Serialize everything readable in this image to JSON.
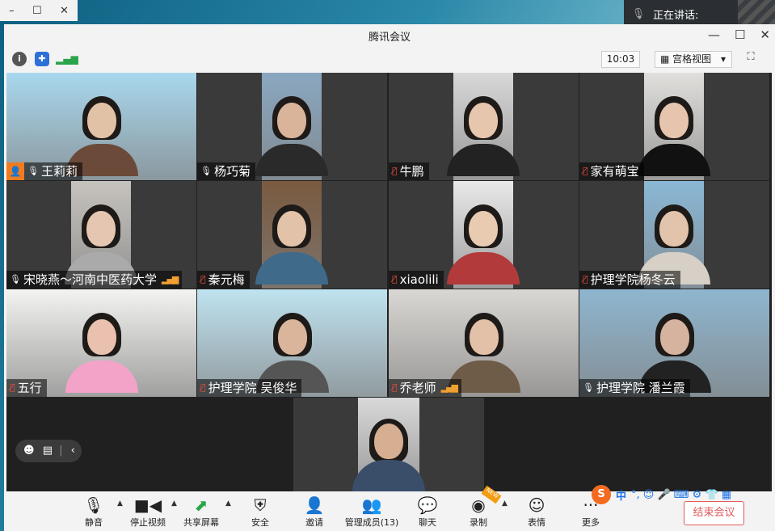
{
  "bg_window": {
    "minimize": "–",
    "maximize": "☐",
    "close": "✕"
  },
  "speaking": {
    "label": "正在讲话:"
  },
  "window": {
    "title": "腾讯会议",
    "minimize": "—",
    "maximize": "☐",
    "close": "✕"
  },
  "info_bar": {
    "time": "10:03",
    "view_label": "宫格视图",
    "view_caret": "▾",
    "fullscreen": "⛶"
  },
  "participants": [
    {
      "name": "王莉莉",
      "mic_on": true,
      "host": true,
      "signal": false
    },
    {
      "name": "杨巧菊",
      "mic_on": true,
      "host": false,
      "signal": false
    },
    {
      "name": "牛鹏",
      "mic_on": false,
      "host": false,
      "signal": false
    },
    {
      "name": "家有萌宝",
      "mic_on": false,
      "host": false,
      "signal": false
    },
    {
      "name": "宋晓燕～河南中医药大学",
      "mic_on": true,
      "host": false,
      "signal": true
    },
    {
      "name": "秦元梅",
      "mic_on": false,
      "host": false,
      "signal": false
    },
    {
      "name": "xiaolili",
      "mic_on": false,
      "host": false,
      "signal": false
    },
    {
      "name": "护理学院杨冬云",
      "mic_on": false,
      "host": false,
      "signal": false
    },
    {
      "name": "五行",
      "mic_on": false,
      "host": false,
      "signal": false
    },
    {
      "name": "护理学院 吴俊华",
      "mic_on": false,
      "host": false,
      "signal": false
    },
    {
      "name": "乔老师",
      "mic_on": false,
      "host": false,
      "signal": true
    },
    {
      "name": "护理学院 潘兰霞",
      "mic_on": true,
      "host": false,
      "signal": false
    },
    {
      "name": "",
      "mic_on": false,
      "host": false,
      "signal": false
    }
  ],
  "chat_control": {
    "emoji": "☻",
    "chat": "▤",
    "collapse": "‹"
  },
  "toolbar": {
    "mute": "静音",
    "stop_video": "停止视频",
    "share_screen": "共享屏幕",
    "security": "安全",
    "invite": "邀请",
    "members": "管理成员(13)",
    "chat": "聊天",
    "record": "录制",
    "reactions": "表情",
    "more": "更多",
    "end": "结束会议",
    "new_badge": "NEW"
  },
  "ime": {
    "logo": "S",
    "lang": "中",
    "items": "°, ☺ 🎤 ⌨ ⚙ 👕 ▦"
  }
}
